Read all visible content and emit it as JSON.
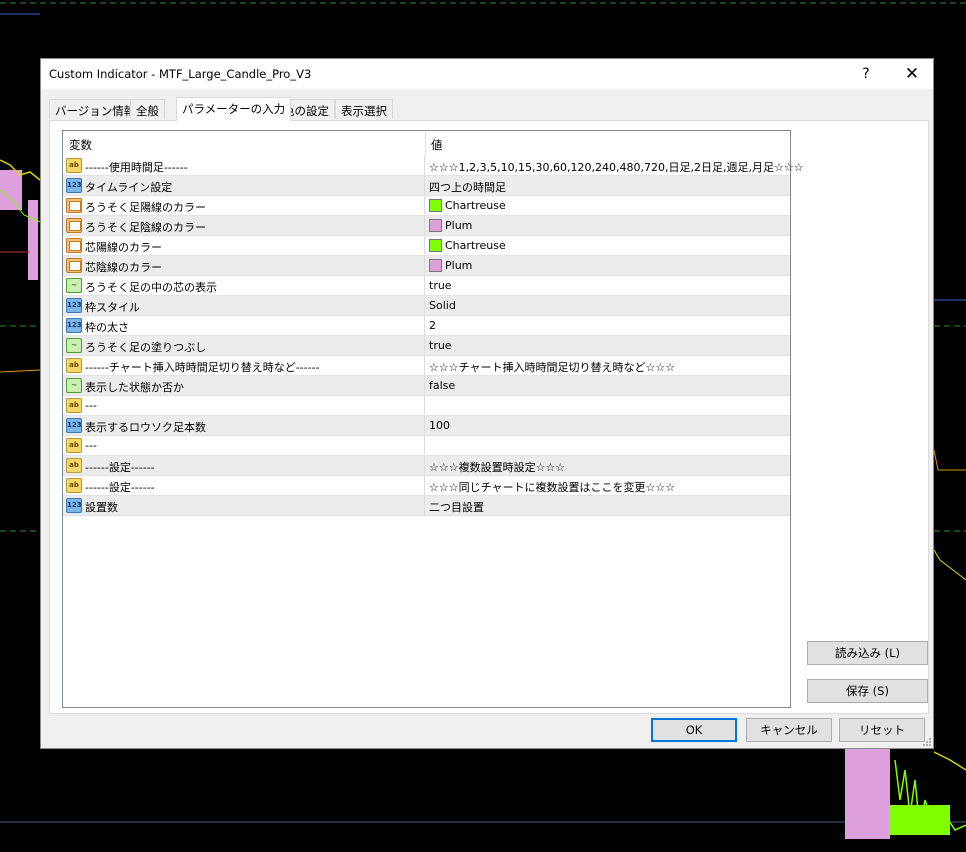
{
  "colors": {
    "chartreuse": "#7FFF00",
    "plum": "#DDA0DD",
    "accent": "#0078d7"
  },
  "window": {
    "title": "Custom Indicator - MTF_Large_Candle_Pro_V3",
    "help": "?",
    "close": "✕"
  },
  "tabs": [
    {
      "label": "バージョン情報"
    },
    {
      "label": "全般"
    },
    {
      "label": "パラメーターの入力"
    },
    {
      "label": "色の設定"
    },
    {
      "label": "表示選択"
    }
  ],
  "grid": {
    "col_name": "変数",
    "col_value": "値",
    "rows": [
      {
        "type": "str",
        "name": "------使用時間足------",
        "value": "☆☆☆1,2,3,5,10,15,30,60,120,240,480,720,日足,2日足,週足,月足☆☆☆"
      },
      {
        "type": "num",
        "name": "タイムライン設定",
        "value": "四つ上の時間足"
      },
      {
        "type": "col",
        "name": "ろうそく足陽線のカラー",
        "value": "Chartreuse",
        "color": "#7FFF00"
      },
      {
        "type": "col",
        "name": "ろうそく足陰線のカラー",
        "value": "Plum",
        "color": "#DDA0DD"
      },
      {
        "type": "col",
        "name": "芯陽線のカラー",
        "value": "Chartreuse",
        "color": "#7FFF00"
      },
      {
        "type": "col",
        "name": "芯陰線のカラー",
        "value": "Plum",
        "color": "#DDA0DD"
      },
      {
        "type": "bool",
        "name": "ろうそく足の中の芯の表示",
        "value": "true"
      },
      {
        "type": "num",
        "name": "枠スタイル",
        "value": "Solid"
      },
      {
        "type": "num",
        "name": "枠の太さ",
        "value": "2"
      },
      {
        "type": "bool",
        "name": "ろうそく足の塗りつぶし",
        "value": "true"
      },
      {
        "type": "str",
        "name": "------チャート挿入時時間足切り替え時など------",
        "value": "☆☆☆チャート挿入時時間足切り替え時など☆☆☆"
      },
      {
        "type": "bool",
        "name": "表示した状態か否か",
        "value": "false"
      },
      {
        "type": "str",
        "name": "---",
        "value": ""
      },
      {
        "type": "num",
        "name": "表示するロウソク足本数",
        "value": "100"
      },
      {
        "type": "str",
        "name": "---",
        "value": ""
      },
      {
        "type": "str",
        "name": "------設定------",
        "value": "☆☆☆複数設置時設定☆☆☆"
      },
      {
        "type": "str",
        "name": "------設定------",
        "value": "☆☆☆同じチャートに複数設置はここを変更☆☆☆"
      },
      {
        "type": "num",
        "name": "設置数",
        "value": "二つ目設置"
      }
    ]
  },
  "buttons": {
    "load": "読み込み (L)",
    "save": "保存 (S)",
    "ok": "OK",
    "cancel": "キャンセル",
    "reset": "リセット"
  }
}
